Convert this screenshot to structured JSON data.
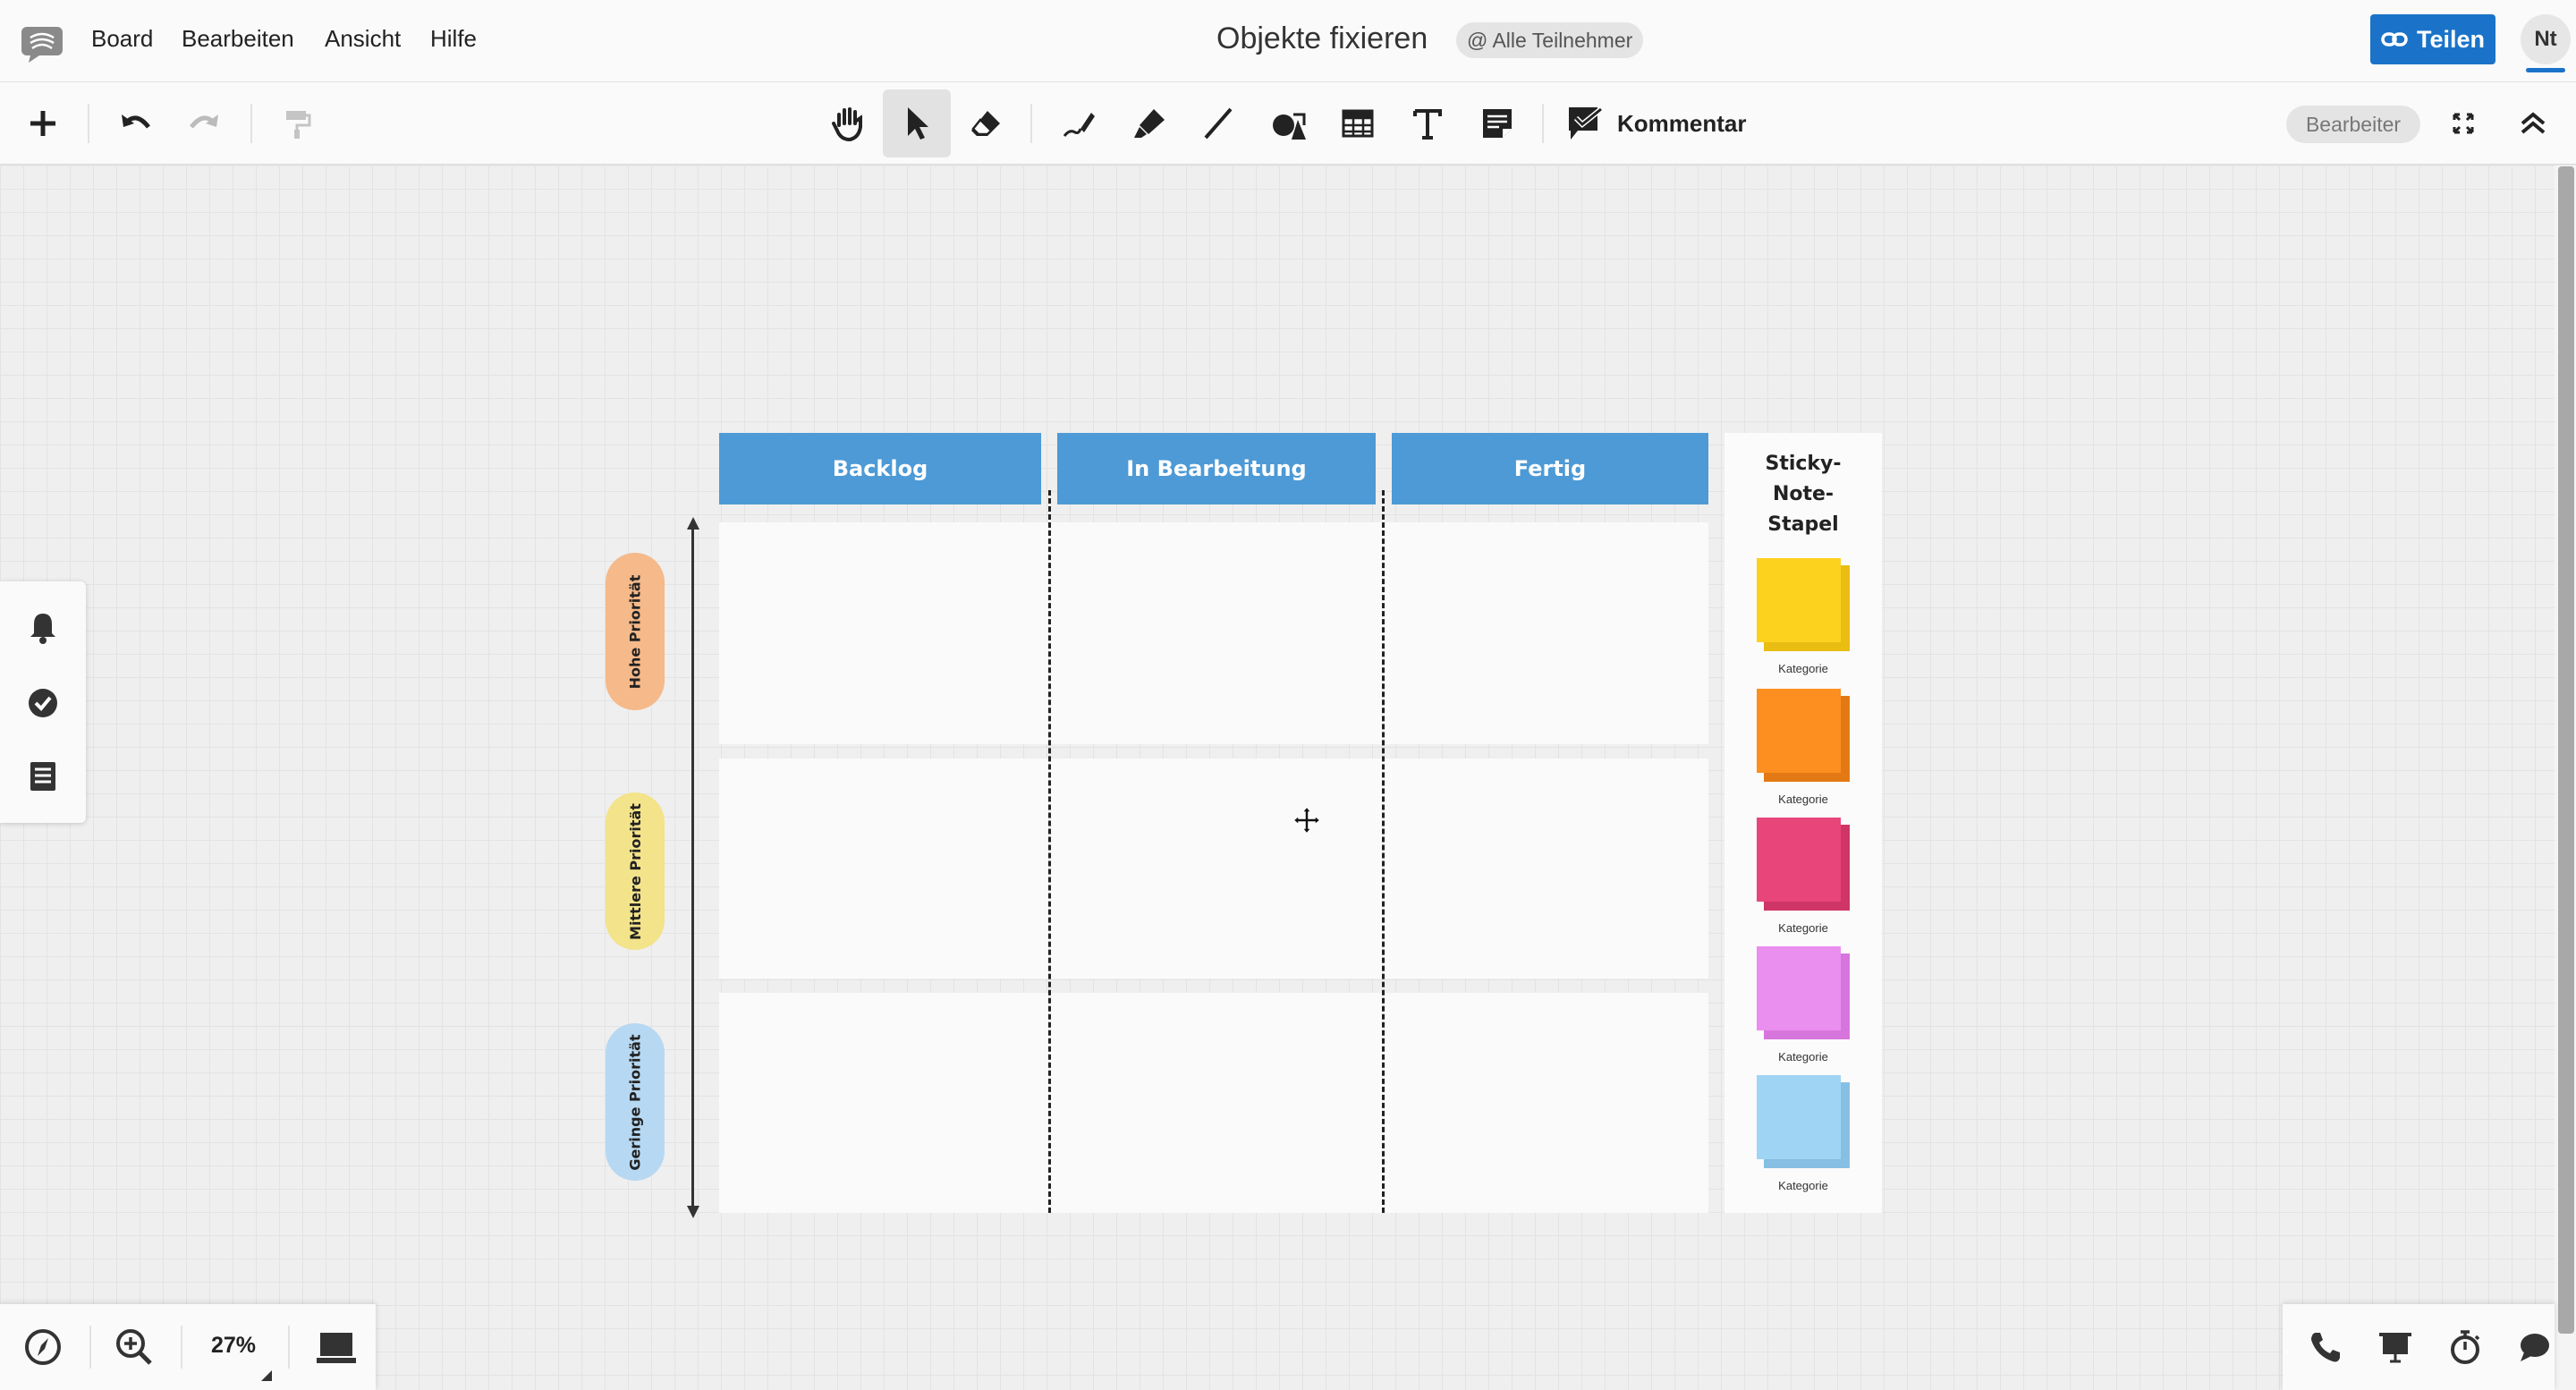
{
  "menubar": {
    "items": [
      "Board",
      "Bearbeiten",
      "Ansicht",
      "Hilfe"
    ],
    "board_title": "Objekte fixieren",
    "participants_badge": "@ Alle Teilnehmer",
    "share_label": "Teilen",
    "avatar_initials": "Nt"
  },
  "toolbar": {
    "comment_label": "Kommentar",
    "role_badge": "Bearbeiter",
    "active_tool": "select-tool"
  },
  "board": {
    "columns": [
      "Backlog",
      "In Bearbeitung",
      "Fertig"
    ],
    "priorities": [
      "Hohe Priorität",
      "Mittlere Priorität",
      "Geringe Priorität"
    ],
    "sticky_stack_title_lines": [
      "Sticky-",
      "Note-",
      "Stapel"
    ],
    "stickies": [
      {
        "label": "Kategorie",
        "color": "#fdd21f",
        "shade": "#e9bd12"
      },
      {
        "label": "Kategorie",
        "color": "#fc8f1f",
        "shade": "#e37914"
      },
      {
        "label": "Kategorie",
        "color": "#e8457a",
        "shade": "#cf3566"
      },
      {
        "label": "Kategorie",
        "color": "#ea8ef0",
        "shade": "#d676dc"
      },
      {
        "label": "Kategorie",
        "color": "#9fd4f5",
        "shade": "#86bfe3"
      }
    ]
  },
  "bottom": {
    "zoom": "27%"
  },
  "colors": {
    "accent": "#1a73c8",
    "column_header": "#4d9ad6",
    "prio_high": "#f5b98a",
    "prio_medium": "#f3e38a",
    "prio_low": "#b7d8f2"
  }
}
